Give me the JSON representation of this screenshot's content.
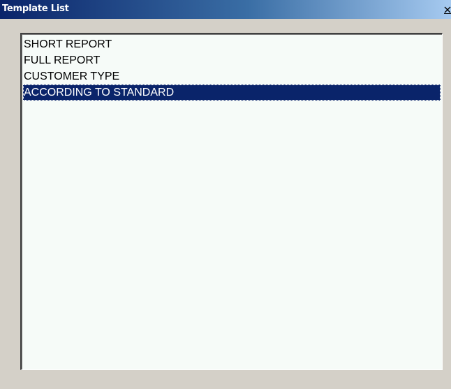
{
  "window": {
    "title": "Template List",
    "close_glyph": "×",
    "colors": {
      "titlebar_start": "#0a246a",
      "titlebar_end": "#a6caf0",
      "selection": "#0a246a",
      "list_background": "#f6fbf8",
      "face": "#d4d0c8"
    }
  },
  "listbox": {
    "items": [
      {
        "label": "SHORT REPORT",
        "selected": false
      },
      {
        "label": "FULL REPORT",
        "selected": false
      },
      {
        "label": "CUSTOMER TYPE",
        "selected": false
      },
      {
        "label": "ACCORDING TO STANDARD",
        "selected": true
      }
    ]
  }
}
